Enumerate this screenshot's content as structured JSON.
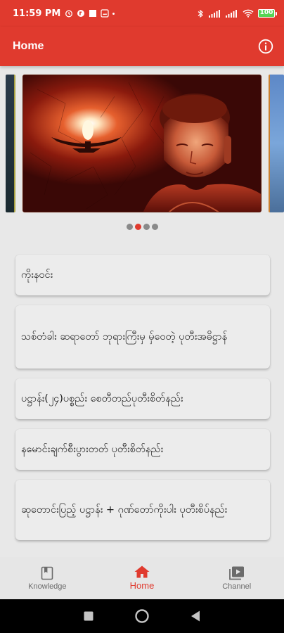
{
  "status_bar": {
    "time": "11:59 PM",
    "battery": "100"
  },
  "app_bar": {
    "title": "Home",
    "info_icon": "info-icon"
  },
  "carousel": {
    "slide_count": 4,
    "active_index": 1
  },
  "list": {
    "items": [
      {
        "label": "ကိုးနဝင်း"
      },
      {
        "label": "သစ်တံခါး ဆရာတော် ဘုရားကြီးမှ မှ်ဝေတဲ့ ပုတီးအဓိဋ္ဌာန်"
      },
      {
        "label": "ပဋ္ဌာန်း(၂၄)ပစ္စည်း စေတီတည်ပုတီးစိတ်နည်း"
      },
      {
        "label": "နမောင်းချက်စီးပွားတတ် ပုတီးစိတ်နည်း"
      },
      {
        "label": "ဆုတောင်းပြည့် ပဋ္ဌာန်း + ဂုဏ်တော်ကိုးပါး ပုတီးစိပ်နည်း"
      }
    ]
  },
  "bottom_nav": {
    "items": [
      {
        "label": "Knowledge",
        "icon": "book-icon"
      },
      {
        "label": "Home",
        "icon": "home-icon"
      },
      {
        "label": "Channel",
        "icon": "video-library-icon"
      }
    ],
    "active": "Home"
  },
  "colors": {
    "primary": "#e03a2e",
    "background": "#e8e8e8",
    "card": "#ececec",
    "inactive": "#6b6b6b"
  }
}
